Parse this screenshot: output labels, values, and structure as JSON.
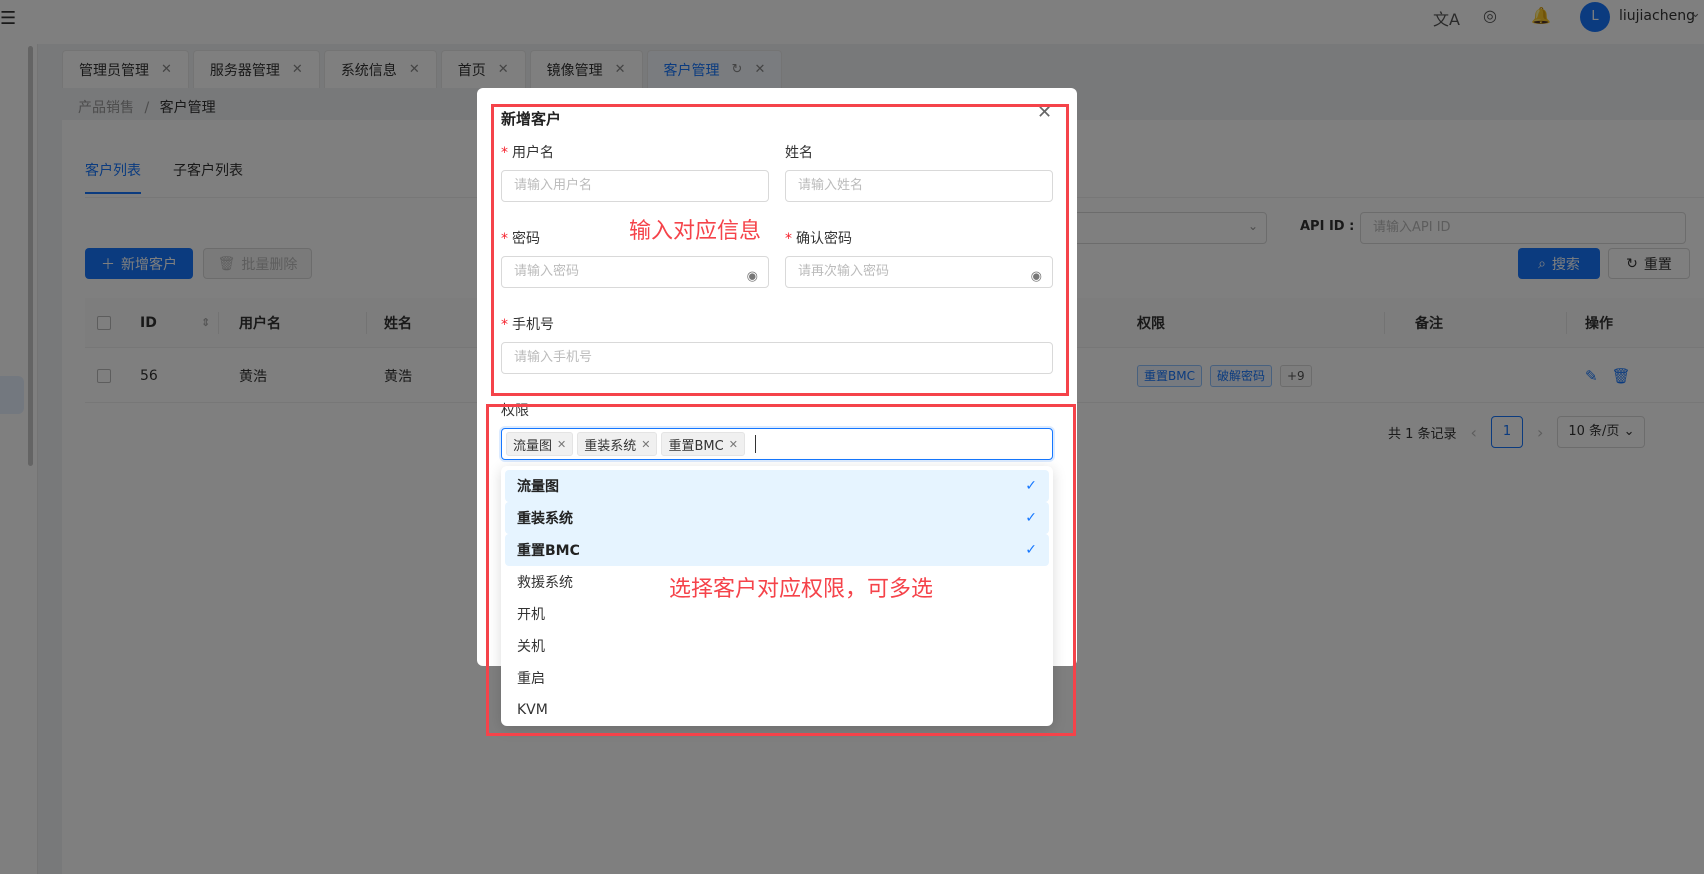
{
  "topbar": {
    "menu_icon": "menu-icon",
    "translate_icon": "translate-icon",
    "theme_icon": "theme-icon",
    "bell_icon": "bell-icon",
    "avatar_letter": "L",
    "username": "liujiacheng"
  },
  "tabs": [
    {
      "label": "管理员管理",
      "closable": true
    },
    {
      "label": "服务器管理",
      "closable": true
    },
    {
      "label": "系统信息",
      "closable": true
    },
    {
      "label": "首页",
      "closable": true
    },
    {
      "label": "镜像管理",
      "closable": true
    },
    {
      "label": "客户管理",
      "closable": true,
      "active": true
    }
  ],
  "breadcrumb": {
    "parent": "产品销售",
    "separator": "/",
    "current": "客户管理"
  },
  "subtabs": [
    {
      "label": "客户列表",
      "active": true
    },
    {
      "label": "子客户列表"
    }
  ],
  "filters": {
    "api_label": "API ID :",
    "api_placeholder": "请输入API ID"
  },
  "buttons": {
    "add": "新增客户",
    "batch_delete": "批量删除",
    "search": "搜索",
    "reset": "重置"
  },
  "table": {
    "headers": {
      "id": "ID",
      "username": "用户名",
      "name": "姓名",
      "permissions": "权限",
      "remark": "备注",
      "ops": "操作"
    },
    "rows": [
      {
        "id": "56",
        "username": "黄浩",
        "name": "黄浩",
        "tags": [
          "重置BMC",
          "破解密码"
        ],
        "more": "+9"
      }
    ]
  },
  "pagination": {
    "total_text": "共 1 条记录",
    "current_page": "1",
    "page_size": "10 条/页"
  },
  "modal": {
    "title": "新增客户",
    "fields": {
      "username": {
        "label": "用户名",
        "required": true,
        "placeholder": "请输入用户名"
      },
      "name": {
        "label": "姓名",
        "required": false,
        "placeholder": "请输入姓名"
      },
      "password": {
        "label": "密码",
        "required": true,
        "placeholder": "请输入密码"
      },
      "confirm": {
        "label": "确认密码",
        "required": true,
        "placeholder": "请再次输入密码"
      },
      "phone": {
        "label": "手机号",
        "required": true,
        "placeholder": "请输入手机号"
      },
      "permissions": {
        "label": "权限"
      }
    },
    "selected_tags": [
      "流量图",
      "重装系统",
      "重置BMC"
    ],
    "options": [
      {
        "label": "流量图",
        "selected": true
      },
      {
        "label": "重装系统",
        "selected": true
      },
      {
        "label": "重置BMC",
        "selected": true
      },
      {
        "label": "救援系统",
        "selected": false
      },
      {
        "label": "开机",
        "selected": false
      },
      {
        "label": "关机",
        "selected": false
      },
      {
        "label": "重启",
        "selected": false
      },
      {
        "label": "KVM",
        "selected": false
      }
    ]
  },
  "annotations": {
    "note1": "输入对应信息",
    "note2": "选择客户对应权限，可多选",
    "box_color": "#f5434a"
  },
  "colors": {
    "primary": "#1677ff",
    "required": "#f5222d"
  }
}
